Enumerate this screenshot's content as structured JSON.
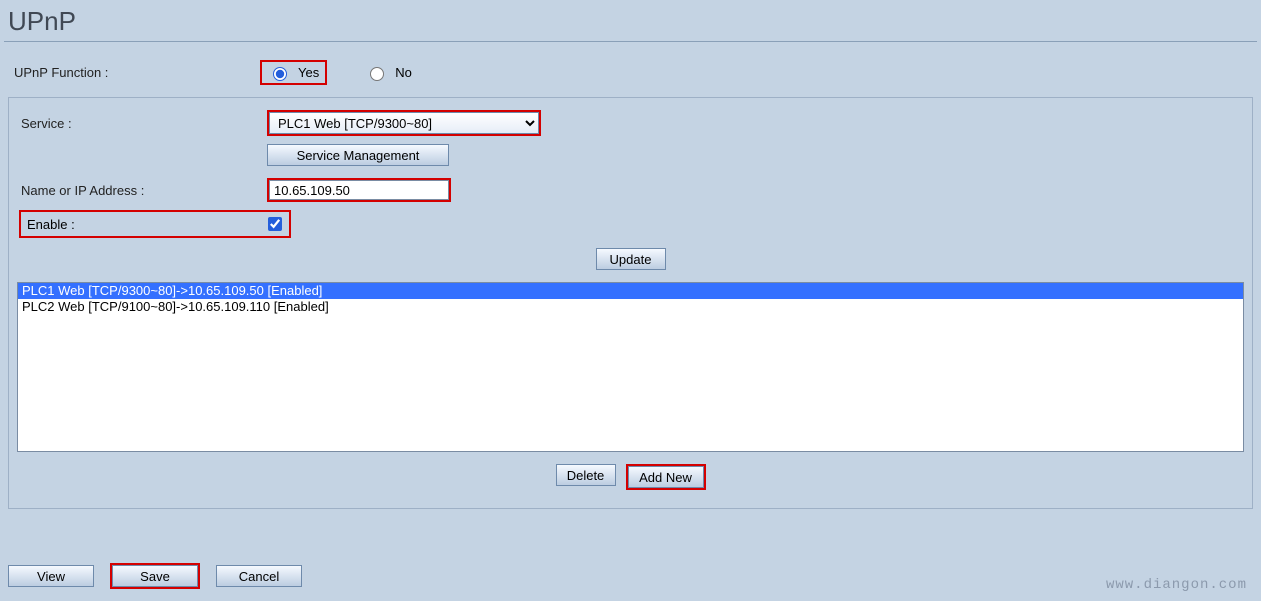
{
  "title": "UPnP",
  "func": {
    "label": "UPnP Function :",
    "yes": "Yes",
    "no": "No"
  },
  "service": {
    "label": "Service :",
    "selected": "PLC1 Web [TCP/9300~80]",
    "manage_btn": "Service Management"
  },
  "ip": {
    "label": "Name or IP Address :",
    "value": "10.65.109.50"
  },
  "enable": {
    "label": "Enable :"
  },
  "buttons": {
    "update": "Update",
    "delete": "Delete",
    "addnew": "Add New",
    "view": "View",
    "save": "Save",
    "cancel": "Cancel"
  },
  "list": {
    "item0": "PLC1 Web [TCP/9300~80]->10.65.109.50 [Enabled]",
    "item1": "PLC2 Web [TCP/9100~80]->10.65.109.110 [Enabled]"
  },
  "watermark": "www.diangon.com"
}
